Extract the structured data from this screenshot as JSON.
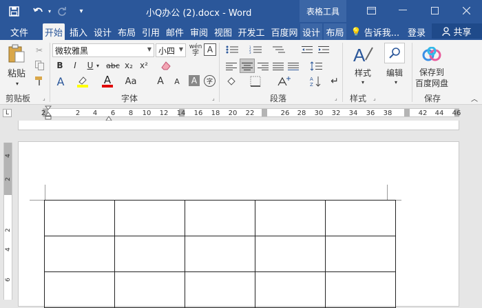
{
  "titlebar": {
    "doc_title": "小Q办公 (2).docx - Word",
    "context_group": "表格工具",
    "save_icon": "save-icon",
    "undo_icon": "undo-icon",
    "redo_icon": "redo-icon"
  },
  "tabs": {
    "file": "文件",
    "home": "开始",
    "insert": "插入",
    "design": "设计",
    "layout": "布局",
    "references": "引用",
    "mailings": "邮件",
    "review": "审阅",
    "view": "视图",
    "developer": "开发工",
    "baidu": "百度网",
    "table_design": "设计",
    "table_layout": "布局",
    "tell_me": "告诉我...",
    "login": "登录",
    "share": "共享"
  },
  "ribbon": {
    "paste": "粘贴",
    "clipboard": "剪贴板",
    "font_name": "微软雅黑",
    "font_size": "小四",
    "wen": "wén",
    "font_group": "字体",
    "bold": "B",
    "italic": "I",
    "underline": "U",
    "strike": "abc",
    "subscript": "x₂",
    "superscript": "x²",
    "font_color_a": "A",
    "aa": "Aa",
    "grow": "A",
    "shrink": "A",
    "char_shade": "A",
    "enclose": "字",
    "paragraph_group": "段落",
    "styles": "样式",
    "styles_group": "样式",
    "editing": "编辑",
    "save_baidu_1": "保存到",
    "save_baidu_2": "百度网盘",
    "save_group": "保存",
    "border_a": "A"
  },
  "ruler": {
    "tab_selector": "L",
    "h_ticks": [
      "2",
      "2",
      "4",
      "6",
      "8",
      "10",
      "12",
      "14",
      "16",
      "18",
      "20",
      "22",
      "26",
      "28",
      "30",
      "32",
      "34",
      "36",
      "38",
      "42",
      "44",
      "46"
    ],
    "v_ticks": [
      "4",
      "2",
      "2",
      "4",
      "6"
    ]
  },
  "table": {
    "rows": 3,
    "cols": 5
  }
}
